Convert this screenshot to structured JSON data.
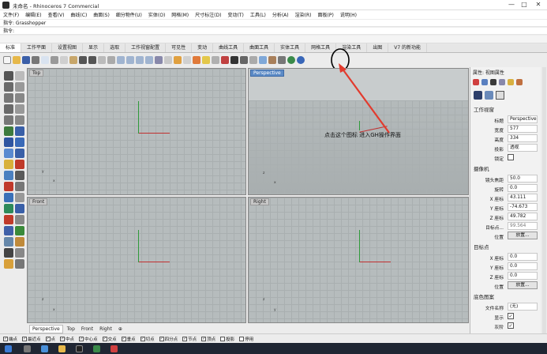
{
  "window": {
    "title": "未命名 - Rhinoceros 7 Commercial",
    "minimize": "—",
    "maximize": "□",
    "close": "✕"
  },
  "menu": [
    "文件(F)",
    "编辑(E)",
    "查看(V)",
    "曲线(C)",
    "曲面(S)",
    "细分物件(U)",
    "实体(O)",
    "网格(M)",
    "尺寸标注(D)",
    "变动(T)",
    "工具(L)",
    "分析(A)",
    "渲染(R)",
    "面板(P)",
    "说明(H)"
  ],
  "command_history": "指令: Grasshopper",
  "command_prompt": "指令:",
  "tabs": [
    "标准",
    "工作平面",
    "设置视图",
    "显示",
    "选取",
    "工作视窗配置",
    "可见性",
    "变动",
    "曲线工具",
    "曲面工具",
    "实体工具",
    "网格工具",
    "渲染工具",
    "出图",
    "V7 的新功能"
  ],
  "active_tab": "标准",
  "viewports": {
    "top": "Top",
    "perspective": "Perspective",
    "front": "Front",
    "right": "Right"
  },
  "axis_labels": {
    "x": "x",
    "y": "y",
    "z": "z"
  },
  "viewport_tabs": [
    "Perspective",
    "Top",
    "Front",
    "Right"
  ],
  "viewport_tab_add": "⊕",
  "annotation": "点击这个图标 进入GH操作界面",
  "panel": {
    "header": "属性: 视图属性",
    "section_view": "工作视窗",
    "title_label": "标题",
    "title_value": "Perspective",
    "width_label": "宽度",
    "width_value": "577",
    "height_label": "高度",
    "height_value": "334",
    "projection_label": "投影",
    "projection_value": "透视",
    "locked_label": "锁定",
    "section_camera": "摄像机",
    "lens_label": "镜头焦距",
    "lens_value": "50.0",
    "rotation_label": "旋转",
    "rotation_value": "0.0",
    "xpos_label": "X 座标",
    "xpos_value": "43.111",
    "ypos_label": "Y 座标",
    "ypos_value": "-74.673",
    "zpos_label": "Z 座标",
    "zpos_value": "49.782",
    "dist_label": "目标点...",
    "dist_value": "99.564",
    "pos_label": "位置",
    "pos_button": "放置...",
    "section_target": "目标点",
    "tx_label": "X 座标",
    "tx_value": "0.0",
    "ty_label": "Y 座标",
    "ty_value": "0.0",
    "tz_label": "Z 座标",
    "tz_value": "0.0",
    "tpos_label": "位置",
    "tpos_button": "放置...",
    "section_wallpaper": "底色图案",
    "file_label": "文件名称",
    "file_value": "(无)",
    "show_label": "显示",
    "gray_label": "灰阶"
  },
  "osnap": [
    "端点",
    "最近点",
    "点",
    "中点",
    "中心点",
    "交点",
    "垂点",
    "切点",
    "四分点",
    "节点",
    "顶点",
    "投影",
    "停用"
  ],
  "colors": {
    "accent": "#5b8ac6",
    "grid_bg": "#b6bcbd",
    "axis_x": "#c03030",
    "axis_y": "#2f9a3a",
    "arrow": "#e23b2e"
  }
}
